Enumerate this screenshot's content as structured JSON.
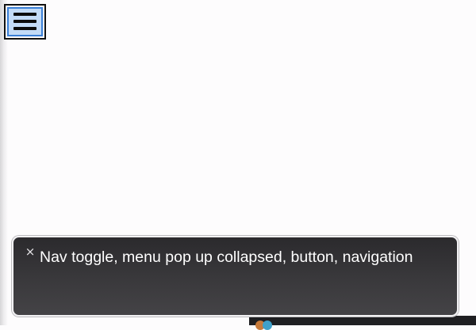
{
  "nav_toggle": {
    "icon": "hamburger-menu-icon",
    "focus_color": "#3a7fd6",
    "focus_fill": "#c3dbf7"
  },
  "voiceover": {
    "close_glyph": "×",
    "caption": "Nav toggle, menu pop up collapsed, button, navigation"
  },
  "dock": {
    "icon": "app-icon"
  }
}
